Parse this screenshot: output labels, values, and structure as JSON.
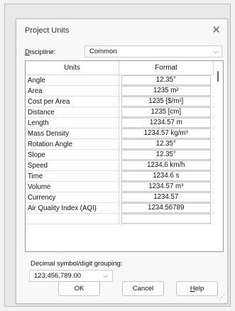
{
  "dialog": {
    "title": "Project Units",
    "close_glyph": "✕"
  },
  "discipline": {
    "label_prefix": "D",
    "label_rest": "iscipline:",
    "value": "Common"
  },
  "table": {
    "headers": [
      "Units",
      "Format"
    ],
    "rows": [
      {
        "name": "Angle",
        "format": "12.35°"
      },
      {
        "name": "Area",
        "format": "1235 m²"
      },
      {
        "name": "Cost per Area",
        "format": "1235 [$/m²]"
      },
      {
        "name": "Distance",
        "format": "1235 [cm]"
      },
      {
        "name": "Length",
        "format": "1234.57 m"
      },
      {
        "name": "Mass Density",
        "format": "1234.57 kg/m³"
      },
      {
        "name": "Rotation Angle",
        "format": "12.35°"
      },
      {
        "name": "Slope",
        "format": "12.35°"
      },
      {
        "name": "Speed",
        "format": "1234.6 km/h"
      },
      {
        "name": "Time",
        "format": "1234.6 s"
      },
      {
        "name": "Volume",
        "format": "1234.57 m³"
      },
      {
        "name": "Currency",
        "format": "1234.57"
      },
      {
        "name": "Air Quality Index (AQI)",
        "format": "1234.56789"
      },
      {
        "name": "",
        "format": ""
      }
    ]
  },
  "decimal": {
    "label_a": "Decimal symbol/digit ",
    "label_g": "g",
    "label_b": "rouping:",
    "value": "123,456,789.00"
  },
  "buttons": {
    "ok": "OK",
    "cancel": "Cancel",
    "help_u": "H",
    "help_rest": "elp"
  },
  "icons": {
    "dropdown": "chevron-down-icon",
    "close": "close-icon",
    "resize": "resize-grip-icon"
  }
}
